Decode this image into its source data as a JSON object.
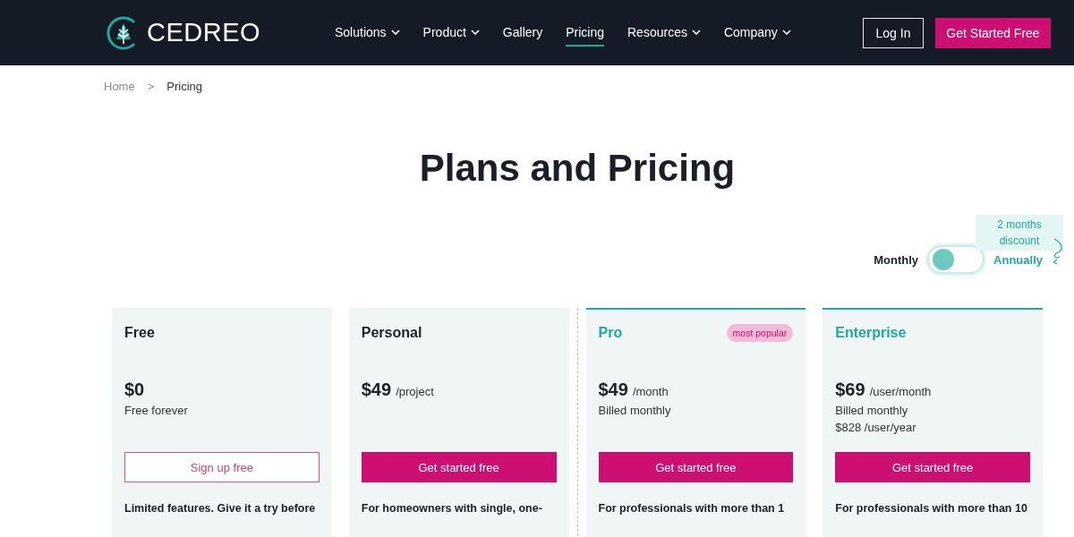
{
  "header": {
    "logo": "CEDREO",
    "nav": [
      {
        "label": "Solutions",
        "dropdown": true,
        "selected": false
      },
      {
        "label": "Product",
        "dropdown": true,
        "selected": false
      },
      {
        "label": "Gallery",
        "dropdown": false,
        "selected": false
      },
      {
        "label": "Pricing",
        "dropdown": false,
        "selected": true
      },
      {
        "label": "Resources",
        "dropdown": true,
        "selected": false
      },
      {
        "label": "Company",
        "dropdown": true,
        "selected": false
      }
    ],
    "login": "Log In",
    "cta": "Get Started Free"
  },
  "breadcrumb": [
    "Home",
    "Pricing"
  ],
  "breadcrumb_separator": ">",
  "title": "Plans and Pricing",
  "billing": {
    "left": "Monthly",
    "right": "Annually",
    "annual": false,
    "note": "2 months discount"
  },
  "plans": [
    {
      "name": "Free",
      "highlighted": false,
      "price": "$0",
      "lines": [
        "Free forever"
      ],
      "button": {
        "label": "Sign up free",
        "kind": "outline"
      },
      "description": "Limited features. Give it a try before"
    },
    {
      "name": "Personal",
      "highlighted": false,
      "price": "$49",
      "unit": "/project",
      "button": {
        "label": "Get started free",
        "kind": "filled"
      },
      "description": "For homeowners with single, one-"
    },
    {
      "name": "Pro",
      "highlighted": true,
      "badge": "most popular",
      "price": "$49",
      "unit": "/month",
      "lines": [
        "Billed monthly"
      ],
      "button": {
        "label": "Get started free",
        "kind": "filled"
      },
      "description": "For professionals with more than 1"
    },
    {
      "name": "Enterprise",
      "highlighted": true,
      "price": "$69",
      "unit": "/user/month",
      "lines": [
        "Billed monthly",
        "$828 /user/year"
      ],
      "button": {
        "label": "Get started free",
        "kind": "filled"
      },
      "description": "For professionals with more than 10"
    }
  ]
}
